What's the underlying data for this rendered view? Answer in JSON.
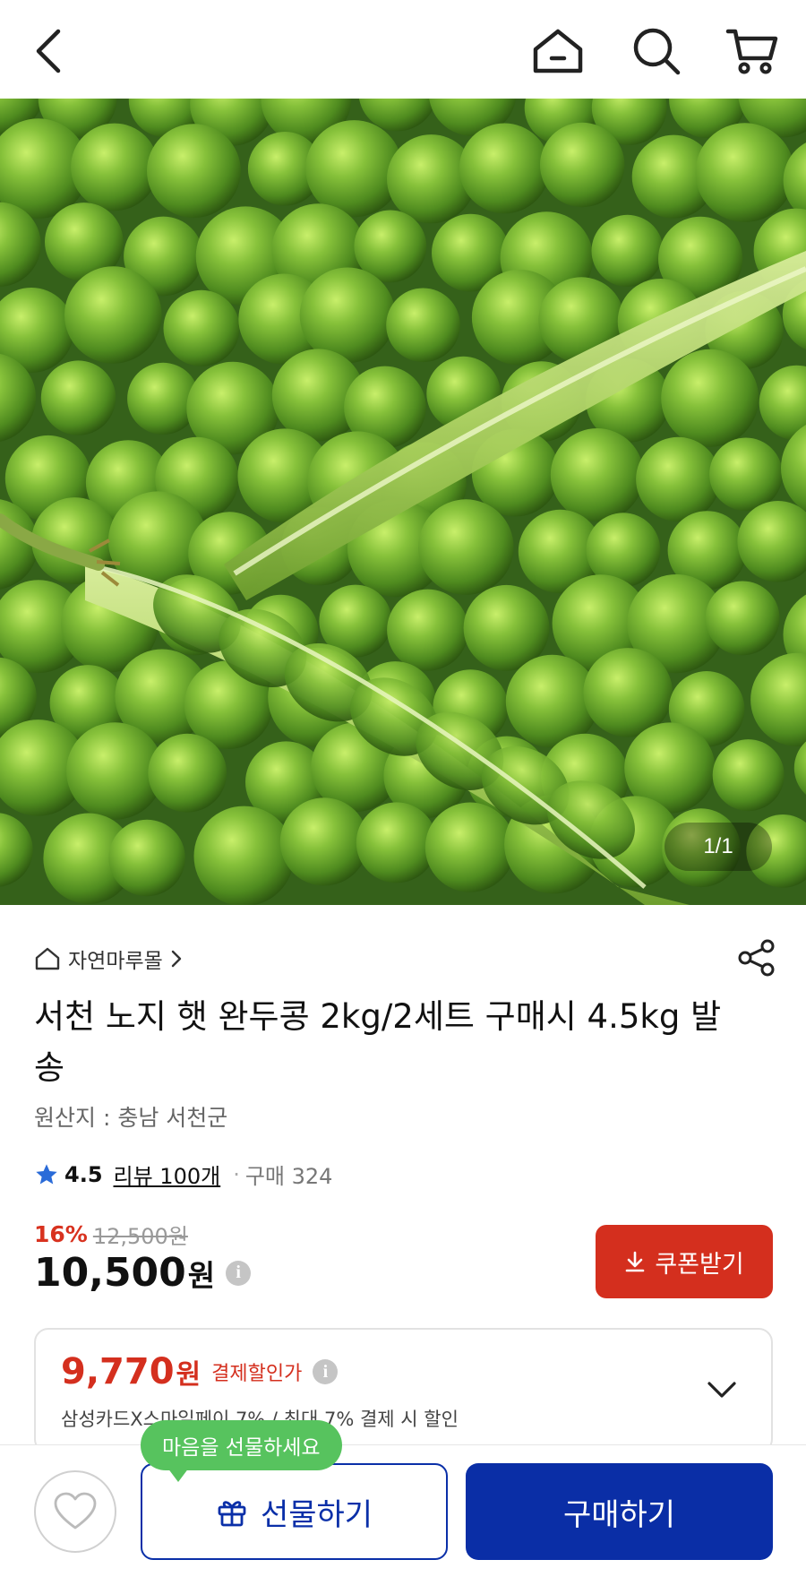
{
  "header": {
    "back_icon": "chevron-left-icon",
    "home_icon": "home-icon",
    "search_icon": "search-icon",
    "cart_icon": "cart-icon"
  },
  "hero": {
    "image_alt": "green peas",
    "page_indicator": "1/1"
  },
  "product": {
    "store_name": "자연마루몰",
    "title": "서천 노지 햇 완두콩 2kg/2세트 구매시 4.5kg 발송",
    "origin": "원산지 : 충남 서천군",
    "rating": "4.5",
    "reviews": "리뷰 100개",
    "purchases": "구매 324",
    "discount_rate": "16%",
    "original_price": "12,500원",
    "price": "10,500",
    "price_unit": "원",
    "coupon_label": "쿠폰받기"
  },
  "payment": {
    "price": "9,770",
    "unit": "원",
    "label": "결제할인가",
    "description": "삼성카드X스마일페이 7% / 최대 7% 결제 시 할인"
  },
  "bottom": {
    "tooltip": "마음을 선물하세요",
    "gift_label": "선물하기",
    "buy_label": "구매하기"
  },
  "colors": {
    "accent_red": "#d42f1e",
    "accent_blue": "#0a2ea6",
    "tooltip_green": "#57c35e",
    "star": "#2a6bd8"
  }
}
